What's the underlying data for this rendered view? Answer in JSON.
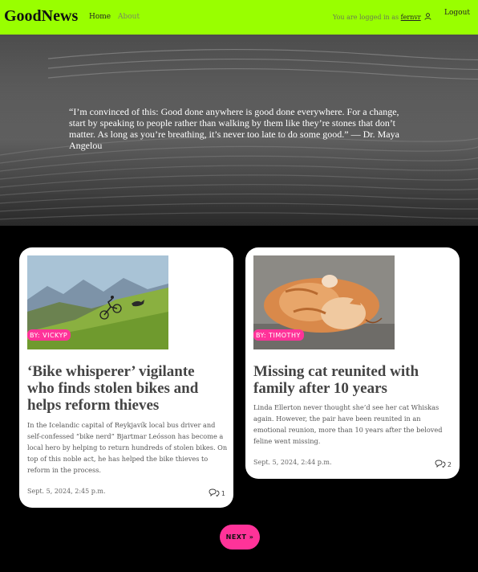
{
  "header": {
    "brand": "GoodNews",
    "nav": [
      {
        "label": "Home"
      },
      {
        "label": "About"
      }
    ],
    "logged_in_prefix": "You are logged in as",
    "username": "fernvr",
    "logout_label": "Logout"
  },
  "hero": {
    "quote": "“I’m convinced of this: Good done anywhere is good done everywhere. For a change, start by speaking to people rather than walking by them like they’re stones that don’t matter. As long as you’re breathing, it’s never too late to do some good.” — Dr. Maya Angelou"
  },
  "posts": [
    {
      "author_badge": "BY: VICKYP",
      "title": "‘Bike whisperer’ vigilante who finds stolen bikes and helps reform thieves",
      "excerpt": "In the Icelandic capital of Reykjavík local bus driver and self-confessed “bike nerd” Bjartmar Leósson has become a local hero by helping to return hundreds of stolen bikes. On top of this noble act, he has helped the bike thieves to reform in the process.",
      "date": "Sept. 5, 2024, 2:45 p.m.",
      "comment_count": "1",
      "image": "mountain-biker-with-dog"
    },
    {
      "author_badge": "BY: TIMOTHY",
      "title": "Missing cat reunited with family after 10 years",
      "excerpt": "Linda Ellerton never thought she’d see her cat Whiskas again. However, the pair have been reunited in an emotional reunion, more than 10 years after the beloved feline went missing.",
      "date": "Sept. 5, 2024, 2:44 p.m.",
      "comment_count": "2",
      "image": "orange-cat-lying-down"
    }
  ],
  "pagination": {
    "next_label": "NEXT »"
  },
  "colors": {
    "header_bg": "#99ff00",
    "accent": "#ff3399",
    "page_bg": "#000000"
  }
}
